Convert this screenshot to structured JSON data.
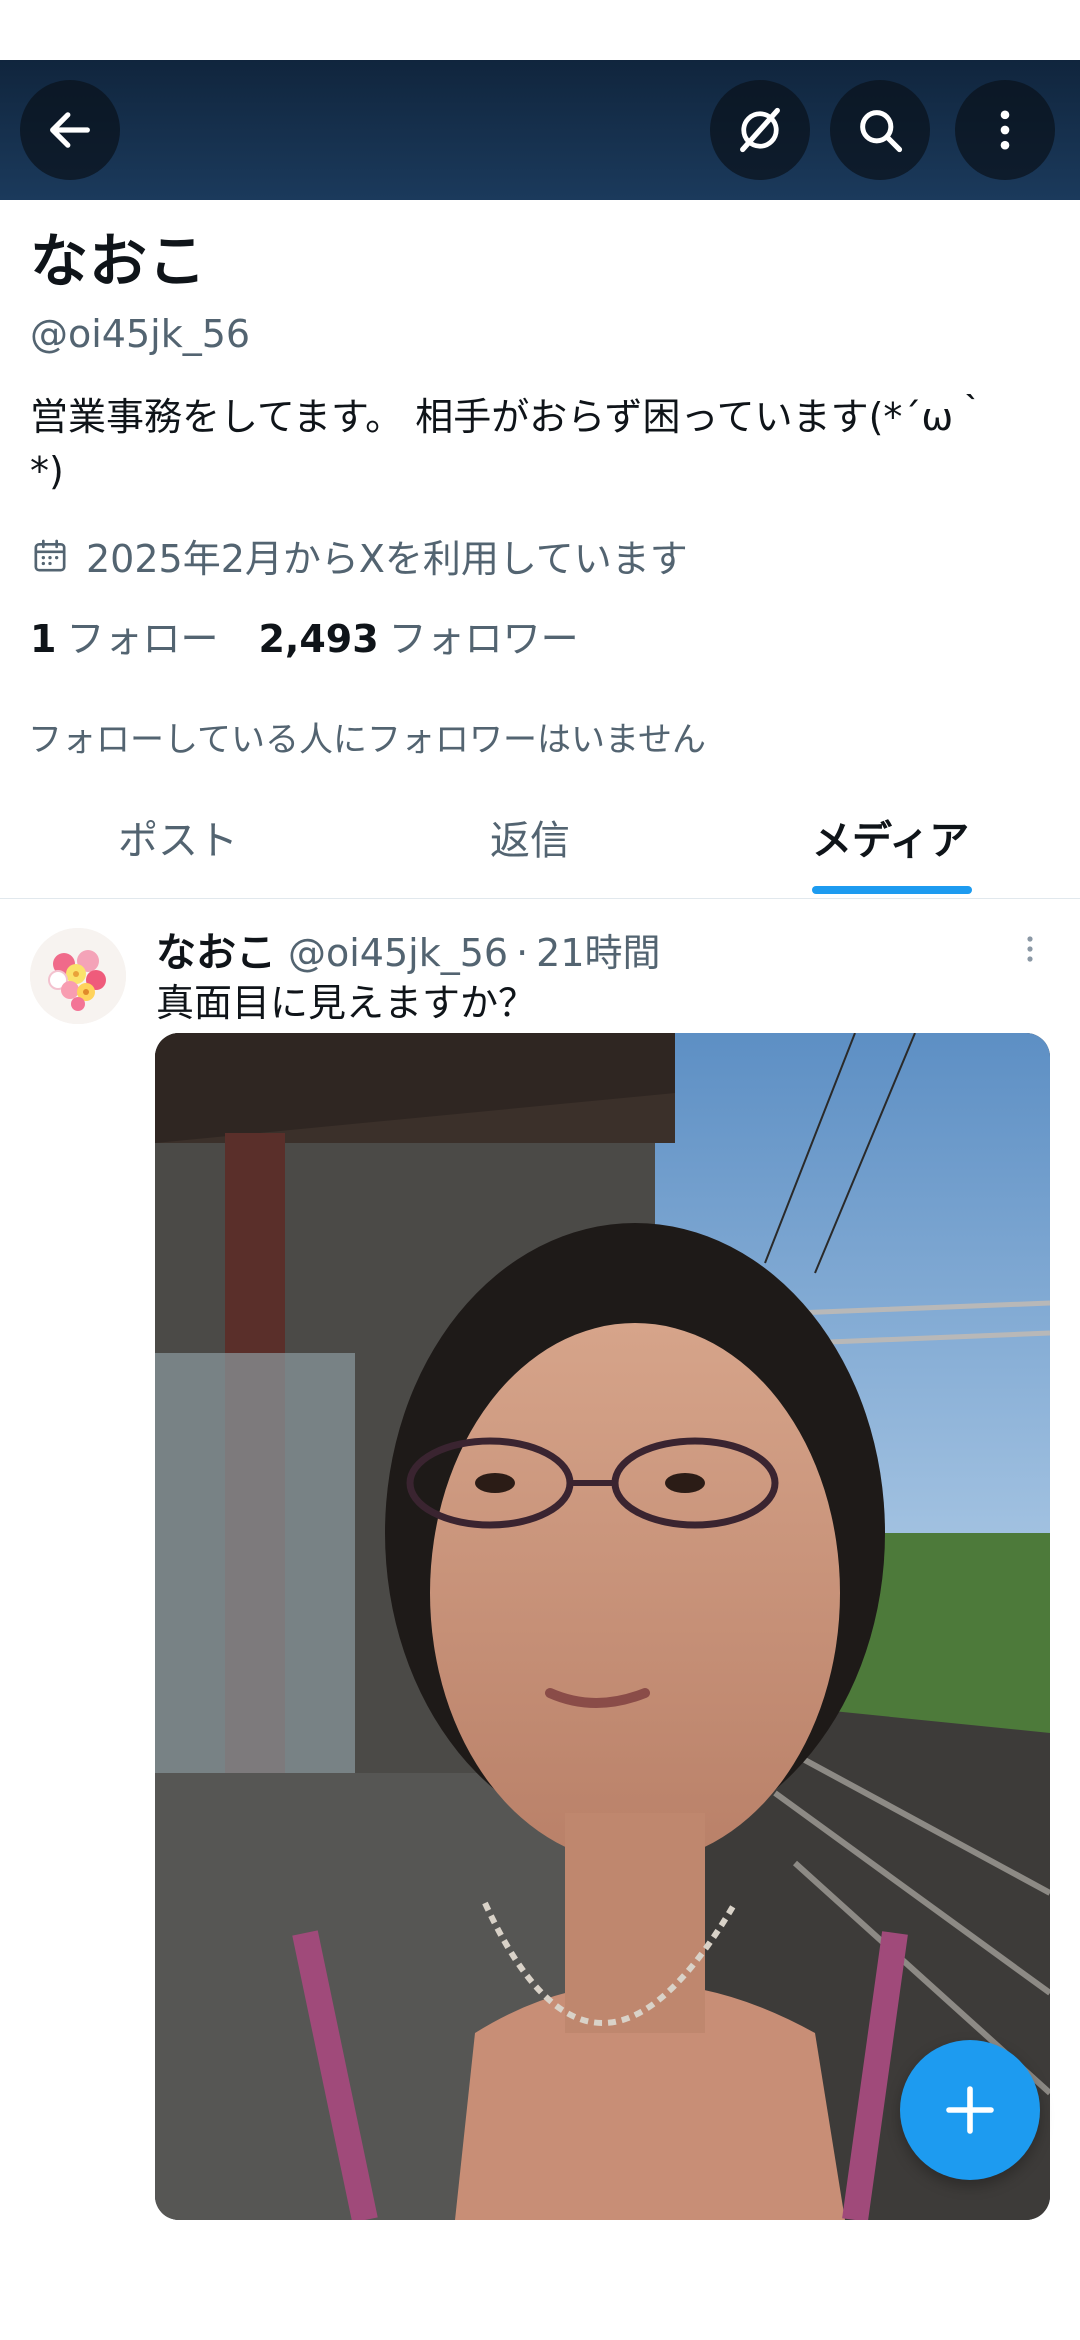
{
  "profile": {
    "display_name": "なおこ",
    "handle": "@oi45jk_56",
    "bio": "営業事務をしてます。 相手がおらず困っています(*´ω｀\n*)",
    "joined": "2025年2月からXを利用しています",
    "following_count": "1",
    "following_label": "フォロー",
    "followers_count": "2,493",
    "followers_label": "フォロワー",
    "no_mutual_followers": "フォローしている人にフォロワーはいません"
  },
  "tabs": [
    {
      "label": "ポスト",
      "active": false
    },
    {
      "label": "返信",
      "active": false
    },
    {
      "label": "メディア",
      "active": true
    }
  ],
  "tweet": {
    "name": "なおこ",
    "handle": "@oi45jk_56",
    "separator": "·",
    "time": "21時間",
    "text": "真面目に見えますか？"
  },
  "icons": {
    "back": "arrow-left-icon",
    "grok": "grok-icon",
    "search": "search-icon",
    "more": "more-vertical-icon",
    "calendar": "calendar-icon",
    "compose": "plus-icon"
  },
  "colors": {
    "accent": "#1d9bf0",
    "header_bg": "#1b3a5c",
    "secondary_text": "#536471"
  }
}
